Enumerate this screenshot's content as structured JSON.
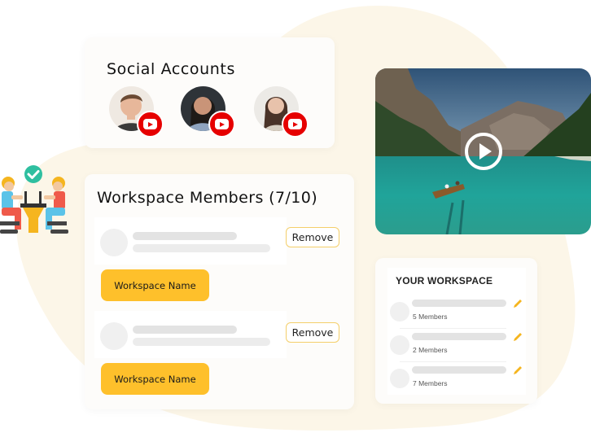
{
  "colors": {
    "accent_yellow": "#fec02b",
    "youtube_red": "#e60000",
    "blob_cream": "#fcf6e8",
    "pencil_orange": "#f5b51f",
    "check_teal": "#2fbfa0"
  },
  "social_accounts": {
    "title": "Social Accounts",
    "accounts": [
      {
        "platform_icon": "youtube-icon",
        "avatar": "man-smiling"
      },
      {
        "platform_icon": "youtube-icon",
        "avatar": "woman-dark-hair-smiling"
      },
      {
        "platform_icon": "youtube-icon",
        "avatar": "woman-long-hair"
      }
    ]
  },
  "video": {
    "thumbnail": "mountain-lake-with-rowboat",
    "play_icon": "play-icon"
  },
  "workspace_members": {
    "title": "Workspace Members (7/10)",
    "members": [
      {
        "action_label": "Remove",
        "workspace_button_label": "Workspace Name"
      },
      {
        "action_label": "Remove",
        "workspace_button_label": "Workspace Name"
      }
    ]
  },
  "your_workspace": {
    "title": "YOUR WORKSPACE",
    "items": [
      {
        "members_label": "5 Members",
        "edit_icon": "pencil-icon"
      },
      {
        "members_label": "2 Members",
        "edit_icon": "pencil-icon"
      },
      {
        "members_label": "7 Members",
        "edit_icon": "pencil-icon"
      }
    ]
  },
  "illustration": {
    "name": "team-meeting-illustration",
    "badge_icon": "check-icon"
  }
}
